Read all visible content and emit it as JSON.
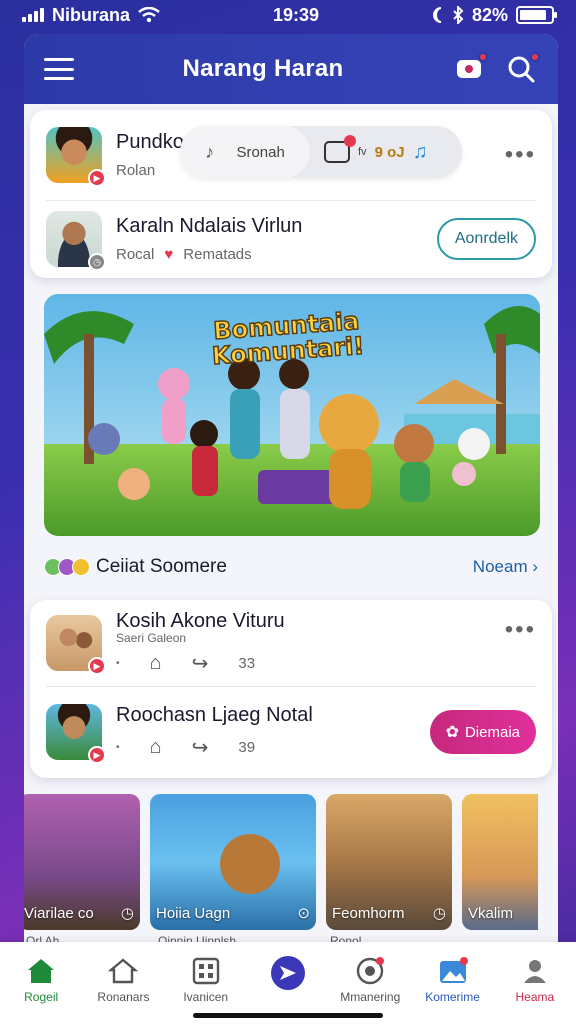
{
  "status_bar": {
    "carrier": "Niburana",
    "time": "19:39",
    "battery": "82%"
  },
  "header": {
    "title": "Narang Haran",
    "menu_icon": "hamburger-icon",
    "actions": [
      "notification-icon",
      "search-icon"
    ]
  },
  "feed_card_1": {
    "row1": {
      "title": "Pundko Kalog Virdhy.",
      "sub": "Rolan",
      "pill_left": "Sronah",
      "pill_badge": "fv",
      "pill_label": "9 oJ"
    },
    "row2": {
      "title": "Karaln Ndalais Virlun",
      "sub_a": "Rocal",
      "sub_b": "Rematads",
      "action": "Aonrdelk"
    }
  },
  "hero": {
    "title_line1": "Bomuntaia",
    "title_line2": "Komuntari!"
  },
  "section": {
    "title": "Ceiiat Soomere",
    "link": "Noeam"
  },
  "feed_card_2": {
    "row1": {
      "title": "Kosih Akone Vituru",
      "sub": "Saeri Galeon",
      "shares": "33"
    },
    "row2": {
      "title": "Roochasn Ljaeg Notal",
      "shares": "39",
      "action": "Diemaia"
    }
  },
  "thumbnails": [
    {
      "label": "Viarilae co"
    },
    {
      "label": "Hoiia Uagn"
    },
    {
      "label": "Feomhorm"
    },
    {
      "label": "Vkalim"
    }
  ],
  "thumbnail_captions": [
    "Orl Ah",
    "Oinnin Uinnlsh",
    "Ronol"
  ],
  "tabs": [
    {
      "label": "Rogeil",
      "icon": "home-icon",
      "active": true
    },
    {
      "label": "Ronanars",
      "icon": "house-outline-icon"
    },
    {
      "label": "Ivanicen",
      "icon": "grid-icon"
    },
    {
      "label": "",
      "icon": "send-icon"
    },
    {
      "label": "Mmanering",
      "icon": "target-icon"
    },
    {
      "label": "Komerime",
      "icon": "image-icon"
    },
    {
      "label": "Heama",
      "icon": "profile-icon"
    }
  ],
  "colors": {
    "accent": "#2d3aa8",
    "pink": "#e0309a",
    "badge": "#e53950",
    "link": "#1e5fa8",
    "active_tab": "#1f8a3a"
  }
}
